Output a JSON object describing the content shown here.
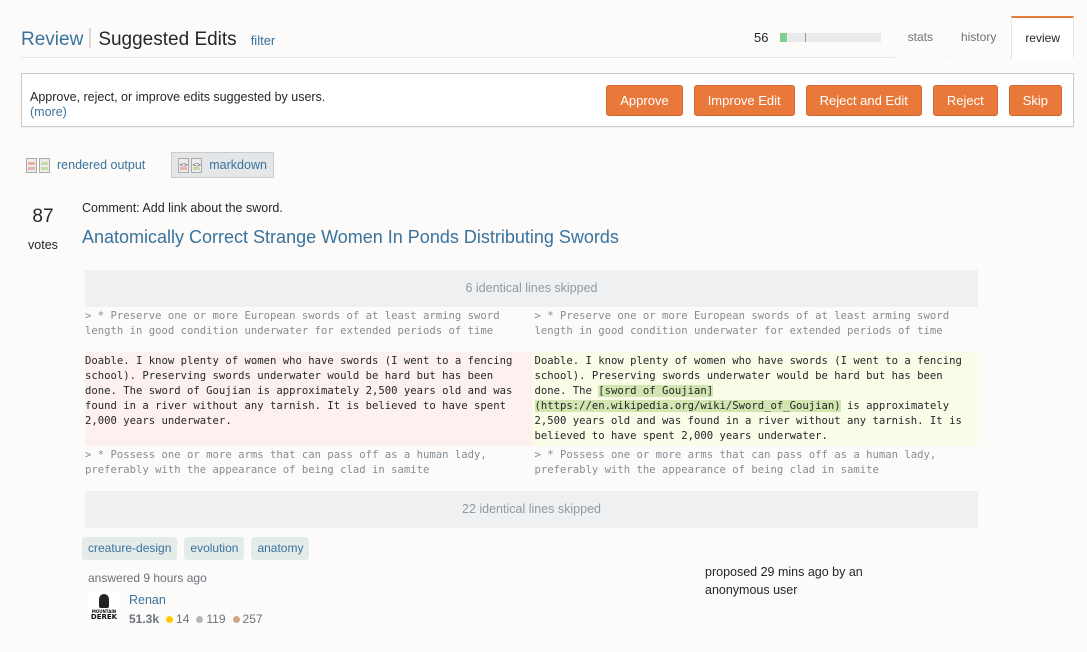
{
  "header": {
    "review_label": "Review",
    "title": "Suggested Edits",
    "filter_label": "filter",
    "progress": {
      "count": "56",
      "fill_fraction": 0.06
    },
    "tabs": [
      {
        "label": "stats",
        "active": false
      },
      {
        "label": "history",
        "active": false
      },
      {
        "label": "review",
        "active": true
      }
    ]
  },
  "panel": {
    "instructions": "Approve, reject, or improve edits suggested by users.",
    "more_label": "(more)",
    "actions": {
      "approve": "Approve",
      "improve": "Improve Edit",
      "reject_and_edit": "Reject and Edit",
      "reject": "Reject",
      "skip": "Skip"
    }
  },
  "view_toggles": {
    "rendered": "rendered output",
    "markdown": "markdown",
    "active": "markdown"
  },
  "post": {
    "votes": "87",
    "votes_label": "votes",
    "comment": "Comment: Add link about the sword.",
    "title": "Anatomically Correct Strange Women In Ponds Distributing Swords"
  },
  "diff": {
    "skipped_top": "6 identical lines skipped",
    "context_1": "> * Preserve one or more European swords of at least arming sword length in good condition underwater for extended periods of time",
    "removed": "Doable. I know plenty of women who have swords (I went to a fencing school). Preserving swords underwater would be hard but has been done. The sword of Goujian is approximately 2,500 years old and was found in a river without any tarnish. It is believed to have spent 2,000 years underwater.",
    "added_before": "Doable. I know plenty of women who have swords (I went to a fencing school). Preserving swords underwater would be hard but has been done. The ",
    "added_highlight_1": "[sword of Goujian]",
    "added_highlight_2": "(https://en.wikipedia.org/wiki/Sword_of_Goujian)",
    "added_after": " is approximately 2,500 years old and was found in a river without any tarnish. It is believed to have spent 2,000 years underwater.",
    "context_2": "> * Possess one or more arms that can pass off as a human lady, preferably with the appearance of being clad in samite",
    "skipped_bottom": "22 identical lines skipped"
  },
  "tags": [
    "creature-design",
    "evolution",
    "anatomy"
  ],
  "author": {
    "answered": "answered 9 hours ago",
    "name": "Renan",
    "avatar_text_1": "MOUNTAIN",
    "avatar_text_2": "DEREK",
    "reputation": "51.3k",
    "gold": "14",
    "silver": "119",
    "bronze": "257"
  },
  "proposed": "proposed 29 mins ago by an anonymous user",
  "colors": {
    "accent_orange": "#e8793a",
    "link_blue": "#39739d",
    "removed_bg": "#fdf1f0",
    "added_bg": "#f9fde8",
    "highlight_bg": "#d3e5b1"
  }
}
